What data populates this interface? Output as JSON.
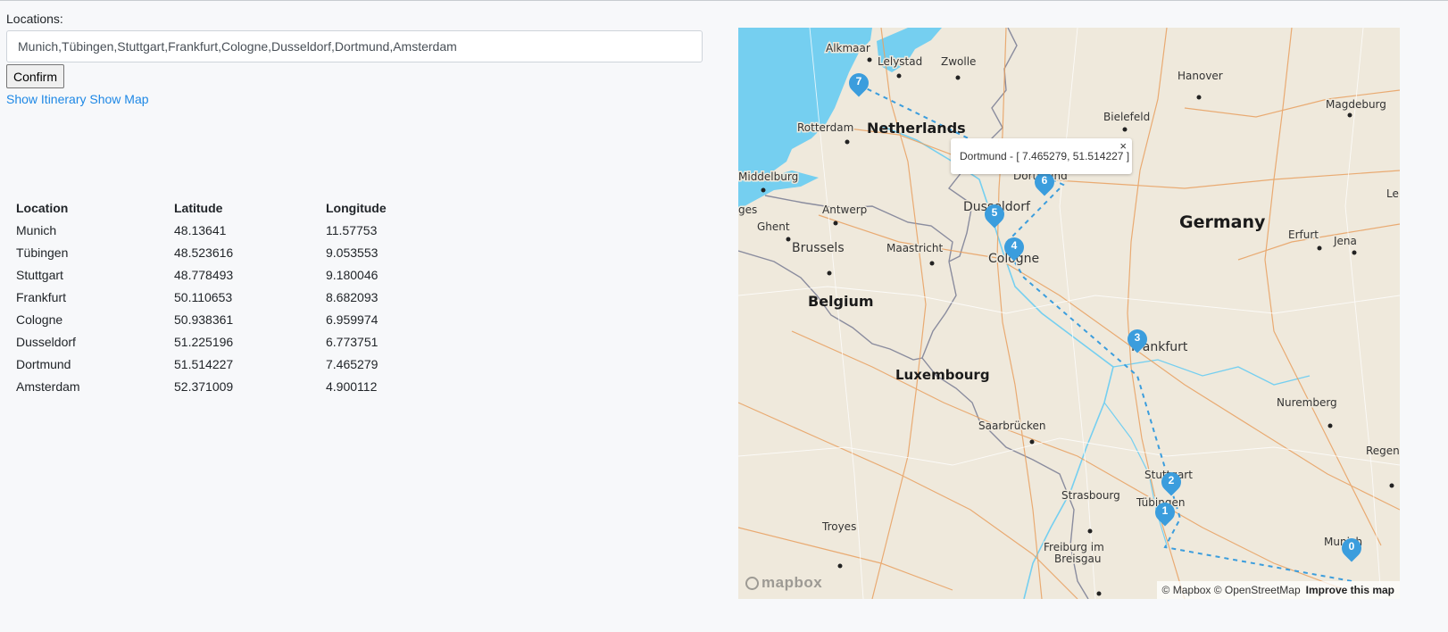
{
  "form": {
    "label": "Locations:",
    "input_value": "Munich,Tübingen,Stuttgart,Frankfurt,Cologne,Dusseldorf,Dortmund,Amsterdam",
    "confirm_label": "Confirm",
    "show_itinerary": "Show Itinerary",
    "show_map": "Show Map"
  },
  "table": {
    "headers": [
      "Location",
      "Latitude",
      "Longitude"
    ],
    "rows": [
      [
        "Munich",
        "48.13641",
        "11.57753"
      ],
      [
        "Tübingen",
        "48.523616",
        "9.053553"
      ],
      [
        "Stuttgart",
        "48.778493",
        "9.180046"
      ],
      [
        "Frankfurt",
        "50.110653",
        "8.682093"
      ],
      [
        "Cologne",
        "50.938361",
        "6.959974"
      ],
      [
        "Dusseldorf",
        "51.225196",
        "6.773751"
      ],
      [
        "Dortmund",
        "51.514227",
        "7.465279"
      ],
      [
        "Amsterdam",
        "52.371009",
        "4.900112"
      ]
    ]
  },
  "map": {
    "country_labels": [
      "Netherlands",
      "Germany",
      "Belgium",
      "Luxembourg"
    ],
    "city_labels": [
      "Alkmaar",
      "Lelystad",
      "Zwolle",
      "Hanover",
      "Magdeburg",
      "Bielefeld",
      "Rotterdam",
      "Middelburg",
      "Antwerp",
      "Ghent",
      "Brussels",
      "Maastricht",
      "Dusseldorf",
      "Cologne",
      "Dortmund",
      "Erfurt",
      "Jena",
      "Frankfurt",
      "Nuremberg",
      "Regensbu",
      "Saarbrücken",
      "Stuttgart",
      "Tübingen",
      "Strasbourg",
      "Troyes",
      "Freiburg im",
      "Breisgau",
      "Munich",
      "Lei",
      "ges"
    ],
    "markers": [
      "0",
      "1",
      "2",
      "3",
      "4",
      "5",
      "6",
      "7"
    ],
    "popup_text": "Dortmund - [ 7.465279, 51.514227 ]",
    "popup_close": "×",
    "attribution": "© Mapbox © OpenStreetMap",
    "improve": "Improve this map",
    "logo": "mapbox",
    "colors": {
      "route": "#3b9ddd",
      "water": "#75cff0",
      "land": "#efe9dc",
      "marker": "#3b9ddd"
    }
  }
}
